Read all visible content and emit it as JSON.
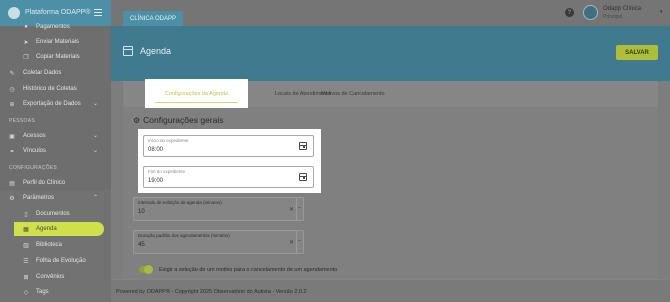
{
  "app": {
    "brand": "Plataforma ODAPP®"
  },
  "sidebar": {
    "items": [
      {
        "label": "Pagamentos",
        "icon": "hand-coin-icon"
      },
      {
        "label": "Enviar Materiais",
        "icon": "send-icon"
      },
      {
        "label": "Copiar Materiais",
        "icon": "copy-icon"
      },
      {
        "label": "Coletar Dados",
        "icon": "pencil-icon"
      },
      {
        "label": "Histórico de Coletas",
        "icon": "history-icon"
      },
      {
        "label": "Exportação de Dados",
        "icon": "export-icon"
      },
      {
        "label": "Acessos",
        "icon": "id-card-icon"
      },
      {
        "label": "Vínculos",
        "icon": "link-icon"
      },
      {
        "label": "Perfil do Clínico",
        "icon": "profile-icon"
      },
      {
        "label": "Parâmetros",
        "icon": "gear-icon"
      },
      {
        "label": "Documentos",
        "icon": "document-icon"
      },
      {
        "label": "Agenda",
        "icon": "calendar-icon"
      },
      {
        "label": "Biblioteca",
        "icon": "library-icon"
      },
      {
        "label": "Folha de Evolução",
        "icon": "list-icon"
      },
      {
        "label": "Convênios",
        "icon": "agreement-icon"
      },
      {
        "label": "Tags",
        "icon": "tag-icon"
      }
    ],
    "sections": {
      "pessoas": "PESSOAS",
      "configuracoes": "CONFIGURAÇÕES"
    }
  },
  "topbar": {
    "clinic_tab": "CLÍNICA ODAPP",
    "help": "?",
    "user_name": "Odapp Clínica",
    "user_role": "Principal"
  },
  "header": {
    "title": "Agenda",
    "save_label": "SALVAR"
  },
  "tabs": [
    {
      "label": "Configurações da Agenda",
      "active": true
    },
    {
      "label": "Locais de Atendimento",
      "active": false
    },
    {
      "label": "Motivos de Cancelamento",
      "active": false
    }
  ],
  "general": {
    "title": "Configurações gerais",
    "start": {
      "label": "Início do expediente",
      "value": "08:00"
    },
    "end": {
      "label": "Fim do expediente",
      "value": "19:00"
    },
    "interval": {
      "label": "Intervalo de exibição da agenda (minutos)",
      "value": "10"
    },
    "duration": {
      "label": "Duração padrão dos agendamentos (minutos)",
      "value": "45"
    },
    "toggle_label": "Exigir a seleção de um motivo para o cancelamento de um agendamento",
    "toggle_on": true
  },
  "footer": {
    "text": "Powered by ODAPP® - Copyright 2025 Observatório do Autista - Versão 2.0.2"
  },
  "colors": {
    "primary": "#4d8fa6",
    "accent": "#cfe04a",
    "save": "#aebe3a"
  }
}
